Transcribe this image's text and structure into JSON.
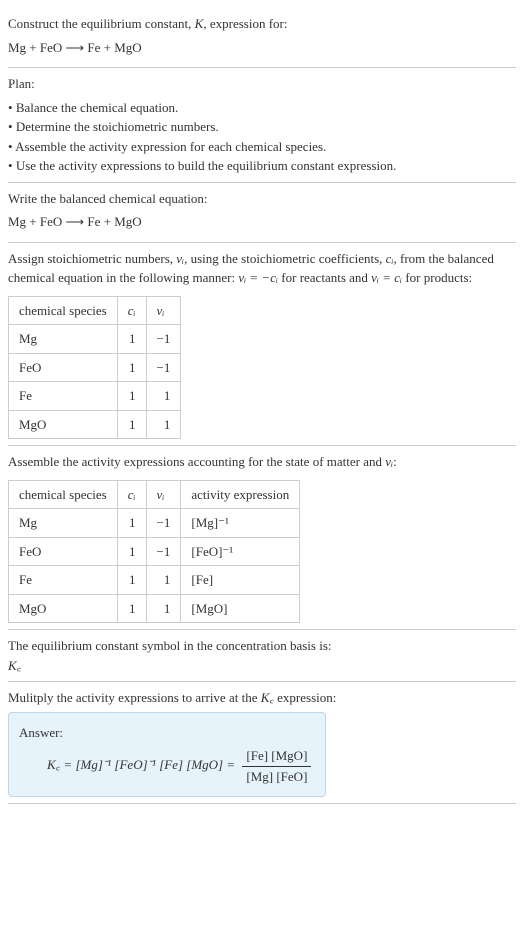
{
  "intro": {
    "line1": "Construct the equilibrium constant, ",
    "k": "K",
    "line2": ", expression for:",
    "equation": "Mg + FeO ⟶ Fe + MgO"
  },
  "plan": {
    "title": "Plan:",
    "items": [
      "Balance the chemical equation.",
      "Determine the stoichiometric numbers.",
      "Assemble the activity expression for each chemical species.",
      "Use the activity expressions to build the equilibrium constant expression."
    ]
  },
  "balanced": {
    "title": "Write the balanced chemical equation:",
    "equation": "Mg + FeO ⟶ Fe + MgO"
  },
  "stoich": {
    "text1": "Assign stoichiometric numbers, ",
    "nu_i": "νᵢ",
    "text2": ", using the stoichiometric coefficients, ",
    "c_i": "cᵢ",
    "text3": ", from the balanced chemical equation in the following manner: ",
    "eq1": "νᵢ = −cᵢ",
    "text4": " for reactants and ",
    "eq2": "νᵢ = cᵢ",
    "text5": " for products:",
    "headers": [
      "chemical species",
      "cᵢ",
      "νᵢ"
    ],
    "rows": [
      {
        "species": "Mg",
        "c": "1",
        "nu": "−1"
      },
      {
        "species": "FeO",
        "c": "1",
        "nu": "−1"
      },
      {
        "species": "Fe",
        "c": "1",
        "nu": "1"
      },
      {
        "species": "MgO",
        "c": "1",
        "nu": "1"
      }
    ]
  },
  "activity": {
    "text1": "Assemble the activity expressions accounting for the state of matter and ",
    "nu_i": "νᵢ",
    "text2": ":",
    "headers": [
      "chemical species",
      "cᵢ",
      "νᵢ",
      "activity expression"
    ],
    "rows": [
      {
        "species": "Mg",
        "c": "1",
        "nu": "−1",
        "expr": "[Mg]⁻¹"
      },
      {
        "species": "FeO",
        "c": "1",
        "nu": "−1",
        "expr": "[FeO]⁻¹"
      },
      {
        "species": "Fe",
        "c": "1",
        "nu": "1",
        "expr": "[Fe]"
      },
      {
        "species": "MgO",
        "c": "1",
        "nu": "1",
        "expr": "[MgO]"
      }
    ]
  },
  "symbol": {
    "text": "The equilibrium constant symbol in the concentration basis is:",
    "kc": "K꜀"
  },
  "multiply": {
    "text1": "Mulitply the activity expressions to arrive at the ",
    "kc": "K꜀",
    "text2": " expression:"
  },
  "answer": {
    "label": "Answer:",
    "lhs": "K꜀ = [Mg]⁻¹ [FeO]⁻¹ [Fe] [MgO] = ",
    "frac_num": "[Fe] [MgO]",
    "frac_den": "[Mg] [FeO]"
  }
}
